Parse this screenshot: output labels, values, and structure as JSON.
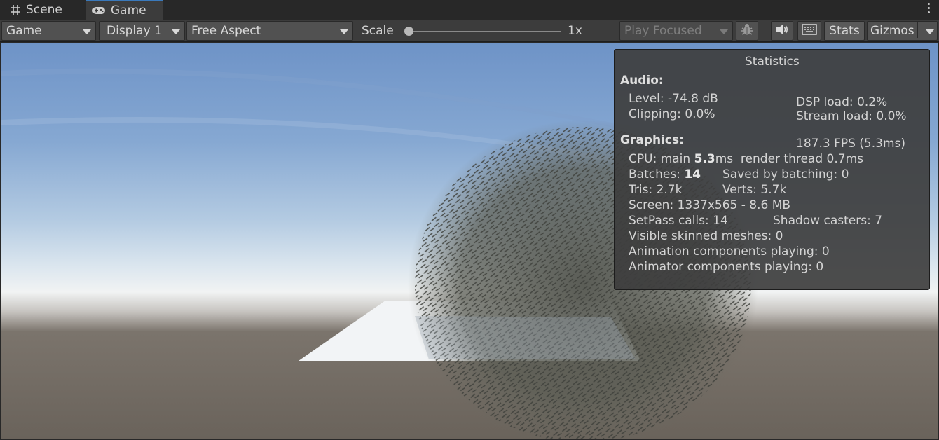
{
  "tabs": {
    "scene": "Scene",
    "game": "Game"
  },
  "toolbar": {
    "game_dropdown": "Game",
    "display_dropdown": "Display 1",
    "aspect_dropdown": "Free Aspect",
    "scale_label": "Scale",
    "scale_value": "1x",
    "play_focused": "Play Focused",
    "stats_button": "Stats",
    "gizmos_button": "Gizmos"
  },
  "statistics": {
    "title": "Statistics",
    "audio": {
      "header": "Audio:",
      "level": "Level: -74.8 dB",
      "clipping": "Clipping: 0.0%",
      "dsp_load": "DSP load: 0.2%",
      "stream_load": "Stream load: 0.0%"
    },
    "graphics": {
      "header": "Graphics:",
      "fps": "187.3 FPS (5.3ms)",
      "cpu_prefix": "CPU: main ",
      "cpu_main": "5.3",
      "cpu_suffix": "ms  render thread 0.7ms",
      "batches_prefix": "Batches: ",
      "batches": "14",
      "saved_by_batching": "Saved by batching: 0",
      "tris": "Tris: 2.7k",
      "verts": "Verts: 5.7k",
      "screen": "Screen: 1337x565 - 8.6 MB",
      "setpass": "SetPass calls: 14",
      "shadow_casters": "Shadow casters: 7",
      "visible_skinned": "Visible skinned meshes: 0",
      "animation_components": "Animation components playing: 0",
      "animator_components": "Animator components playing: 0"
    }
  },
  "colors": {
    "accent_tab": "#3a79bb",
    "toolbar_bg": "#3c3c3c",
    "button_bg": "#515151"
  },
  "icons": [
    "grid-icon",
    "gamepad-icon",
    "bug-icon",
    "speaker-icon",
    "keyboard-icon",
    "kebab-menu-icon"
  ]
}
